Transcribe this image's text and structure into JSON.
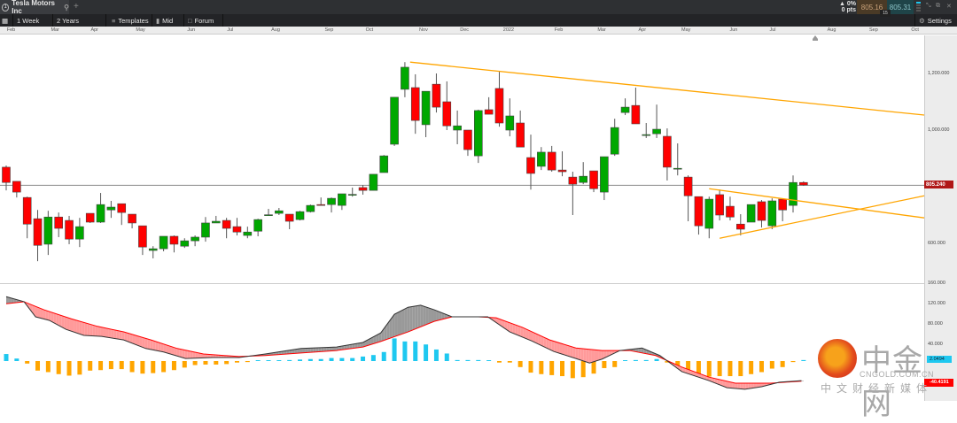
{
  "tab": {
    "index": "1",
    "title": "Tesla Motors Inc",
    "new_tab": "+"
  },
  "quote": {
    "change_pct": "▲ 0%",
    "change_pts": "0 pts",
    "sell": "805.16",
    "buy": "805.31",
    "spread": "15"
  },
  "toolbar": {
    "interval": "1 Week",
    "range": "2 Years",
    "templates": "Templates",
    "mid": "Mid",
    "forum": "Forum",
    "settings": "Settings"
  },
  "window": {
    "minimize": "⤡",
    "popout": "⧉",
    "close": "✕"
  },
  "price_axis_labels": [
    "1,200.000",
    "1,000.000",
    "600.000"
  ],
  "current_price_label": "805.240",
  "macd_axis_labels": [
    "160.000",
    "120.000",
    "80.000",
    "40.000"
  ],
  "macd_value_label": "2.0494",
  "signal_value_label": "-40.4191",
  "watermark": {
    "name": "中金网",
    "url": "CNGOLD.COM.CN",
    "tagline": "中文财经新媒体"
  },
  "colors": {
    "up": "#00a800",
    "down": "#ff0000",
    "trend": "#ffa500",
    "macd_pos": "#1ec8f0",
    "macd_neg": "#ffa500",
    "signal": "#ff0000",
    "current": "#b01818"
  },
  "chart_data": {
    "type": "candlestick",
    "symbol": "Tesla Motors Inc",
    "interval": "1 Week",
    "price_ticks": [
      1200,
      1000,
      600
    ],
    "current_price": 805.24,
    "x_ticks": [
      {
        "label": "Feb",
        "week": 0.4
      },
      {
        "label": "Mar",
        "week": 4.6
      },
      {
        "label": "Apr",
        "week": 8.4
      },
      {
        "label": "May",
        "week": 12.7
      },
      {
        "label": "Jun",
        "week": 17.6
      },
      {
        "label": "Jul",
        "week": 21.4
      },
      {
        "label": "Aug",
        "week": 25.6
      },
      {
        "label": "Sep",
        "week": 30.7
      },
      {
        "label": "Oct",
        "week": 34.6
      },
      {
        "label": "Nov",
        "week": 39.7
      },
      {
        "label": "Dec",
        "week": 43.6
      },
      {
        "label": "2022",
        "week": 47.7
      },
      {
        "label": "Feb",
        "week": 52.6
      },
      {
        "label": "Mar",
        "week": 56.7
      },
      {
        "label": "Apr",
        "week": 60.6
      },
      {
        "label": "May",
        "week": 64.7
      },
      {
        "label": "Jun",
        "week": 69.3
      },
      {
        "label": "Jul",
        "week": 73.1
      },
      {
        "label": "Aug",
        "week": 78.6
      },
      {
        "label": "Sep",
        "week": 82.6
      },
      {
        "label": "Oct",
        "week": 86.6
      }
    ],
    "ohlc": [
      [
        869,
        875,
        787,
        815
      ],
      [
        819,
        819,
        762,
        781
      ],
      [
        762,
        765,
        618,
        668
      ],
      [
        687,
        718,
        537,
        593
      ],
      [
        597,
        715,
        559,
        693
      ],
      [
        693,
        709,
        622,
        653
      ],
      [
        681,
        697,
        597,
        615
      ],
      [
        615,
        690,
        587,
        659
      ],
      [
        706,
        706,
        672,
        675
      ],
      [
        675,
        778,
        672,
        737
      ],
      [
        718,
        750,
        690,
        728
      ],
      [
        740,
        740,
        665,
        709
      ],
      [
        703,
        703,
        653,
        672
      ],
      [
        662,
        662,
        559,
        587
      ],
      [
        575,
        590,
        547,
        581
      ],
      [
        581,
        625,
        572,
        625
      ],
      [
        625,
        628,
        568,
        597
      ],
      [
        590,
        618,
        584,
        609
      ],
      [
        609,
        628,
        590,
        622
      ],
      [
        622,
        693,
        606,
        672
      ],
      [
        672,
        697,
        672,
        678
      ],
      [
        681,
        690,
        618,
        653
      ],
      [
        659,
        690,
        628,
        640
      ],
      [
        628,
        659,
        618,
        640
      ],
      [
        643,
        687,
        625,
        684
      ],
      [
        700,
        722,
        700,
        701
      ],
      [
        706,
        725,
        700,
        715
      ],
      [
        703,
        703,
        650,
        678
      ],
      [
        684,
        715,
        681,
        712
      ],
      [
        712,
        737,
        709,
        734
      ],
      [
        737,
        762,
        734,
        734
      ],
      [
        737,
        762,
        709,
        759
      ],
      [
        734,
        775,
        718,
        775
      ],
      [
        772,
        797,
        765,
        773
      ],
      [
        797,
        806,
        772,
        787
      ],
      [
        787,
        844,
        787,
        844
      ],
      [
        850,
        912,
        850,
        909
      ],
      [
        950,
        1116,
        944,
        1116
      ],
      [
        1144,
        1240,
        1116,
        1222
      ],
      [
        1150,
        1197,
        987,
        1034
      ],
      [
        1019,
        1137,
        975,
        1137
      ],
      [
        1162,
        1200,
        1062,
        1081
      ],
      [
        1100,
        1172,
        1000,
        1015
      ],
      [
        1000,
        1069,
        950,
        1015
      ],
      [
        1000,
        1000,
        909,
        931
      ],
      [
        909,
        1072,
        884,
        1069
      ],
      [
        1072,
        1116,
        1056,
        1056
      ],
      [
        1147,
        1206,
        1012,
        1025
      ],
      [
        1000,
        1112,
        978,
        1050
      ],
      [
        1025,
        1069,
        940,
        940
      ],
      [
        903,
        984,
        790,
        847
      ],
      [
        872,
        940,
        859,
        922
      ],
      [
        922,
        944,
        853,
        859
      ],
      [
        859,
        925,
        837,
        853
      ],
      [
        834,
        853,
        700,
        809
      ],
      [
        815,
        887,
        809,
        837
      ],
      [
        856,
        856,
        781,
        793
      ],
      [
        781,
        906,
        753,
        906
      ],
      [
        915,
        1040,
        909,
        1009
      ],
      [
        1062,
        1112,
        1053,
        1081
      ],
      [
        1087,
        1150,
        1022,
        1022
      ],
      [
        981,
        1025,
        972,
        984
      ],
      [
        987,
        1090,
        972,
        1003
      ],
      [
        978,
        1006,
        822,
        869
      ],
      [
        862,
        953,
        840,
        865
      ],
      [
        834,
        840,
        678,
        768
      ],
      [
        765,
        765,
        631,
        662
      ],
      [
        653,
        765,
        618,
        756
      ],
      [
        772,
        790,
        681,
        700
      ],
      [
        731,
        765,
        681,
        693
      ],
      [
        668,
        703,
        628,
        650
      ],
      [
        675,
        737,
        675,
        737
      ],
      [
        747,
        753,
        656,
        681
      ],
      [
        662,
        759,
        650,
        750
      ],
      [
        756,
        759,
        678,
        718
      ],
      [
        734,
        840,
        709,
        815
      ],
      [
        815,
        819,
        803,
        806
      ]
    ],
    "trendlines": [
      {
        "from": [
          38.5,
          1240
        ],
        "to": [
          87.5,
          1053
        ]
      },
      {
        "from": [
          67,
          793
        ],
        "to": [
          87.5,
          690
        ]
      },
      {
        "from": [
          68,
          618
        ],
        "to": [
          87.5,
          768
        ]
      }
    ],
    "macd": {
      "ticks": [
        160,
        120,
        80,
        40
      ],
      "macd_line": [
        [
          0,
          128
        ],
        [
          1.7,
          118
        ],
        [
          2.8,
          88
        ],
        [
          4.1,
          81
        ],
        [
          5.7,
          63
        ],
        [
          7.4,
          51
        ],
        [
          9.1,
          49
        ],
        [
          11.2,
          42
        ],
        [
          13.3,
          25
        ],
        [
          15,
          18
        ],
        [
          17.1,
          5
        ],
        [
          19.7,
          7
        ],
        [
          22.2,
          7
        ],
        [
          24.7,
          14
        ],
        [
          28.1,
          25
        ],
        [
          31.5,
          28
        ],
        [
          34,
          37
        ],
        [
          35.7,
          56
        ],
        [
          37,
          93
        ],
        [
          38.3,
          107
        ],
        [
          39.5,
          111
        ],
        [
          40.8,
          102
        ],
        [
          42.5,
          88
        ],
        [
          45.9,
          88
        ],
        [
          48,
          58
        ],
        [
          50.1,
          40
        ],
        [
          52.2,
          19
        ],
        [
          54.3,
          5
        ],
        [
          55.6,
          -4
        ],
        [
          56.8,
          4
        ],
        [
          58.5,
          21
        ],
        [
          60.6,
          26
        ],
        [
          62.3,
          11
        ],
        [
          64.4,
          -21
        ],
        [
          67,
          -39
        ],
        [
          68.7,
          -53
        ],
        [
          70.4,
          -56
        ],
        [
          72,
          -51
        ],
        [
          73.7,
          -42
        ],
        [
          75.8,
          -39
        ]
      ],
      "signal_line": [
        [
          0,
          114
        ],
        [
          1.7,
          118
        ],
        [
          3.6,
          102
        ],
        [
          6.2,
          84
        ],
        [
          8.7,
          69
        ],
        [
          11.2,
          58
        ],
        [
          13.8,
          42
        ],
        [
          16.3,
          25
        ],
        [
          18.8,
          14
        ],
        [
          22.2,
          9
        ],
        [
          24.7,
          11
        ],
        [
          28.1,
          16
        ],
        [
          31.5,
          21
        ],
        [
          34,
          28
        ],
        [
          35.7,
          39
        ],
        [
          38.3,
          58
        ],
        [
          40.8,
          79
        ],
        [
          42.5,
          88
        ],
        [
          45,
          88
        ],
        [
          46.7,
          86
        ],
        [
          49.2,
          67
        ],
        [
          51.8,
          42
        ],
        [
          54.3,
          26
        ],
        [
          56.8,
          21
        ],
        [
          59.4,
          21
        ],
        [
          61.9,
          11
        ],
        [
          64.4,
          -12
        ],
        [
          67,
          -32
        ],
        [
          69.5,
          -44
        ],
        [
          72.9,
          -44
        ],
        [
          75.8,
          -40
        ]
      ],
      "histogram": [
        14,
        5,
        -5,
        -19,
        -22,
        -26,
        -29,
        -27,
        -19,
        -18,
        -16,
        -16,
        -22,
        -25,
        -24,
        -22,
        -18,
        -13,
        -8,
        -7,
        -7,
        -6,
        -3,
        -2,
        0,
        1,
        1,
        2,
        3,
        4,
        4,
        6,
        6,
        6,
        9,
        12,
        18,
        45,
        39,
        39,
        33,
        23,
        15,
        2,
        2,
        2,
        1,
        -3,
        -3,
        -12,
        -23,
        -26,
        -28,
        -30,
        -34,
        -32,
        -25,
        -14,
        -12,
        0,
        2,
        2,
        4,
        -3,
        -9,
        -18,
        -28,
        -31,
        -30,
        -30,
        -30,
        -26,
        -22,
        -15,
        -12,
        -2,
        2
      ]
    }
  }
}
